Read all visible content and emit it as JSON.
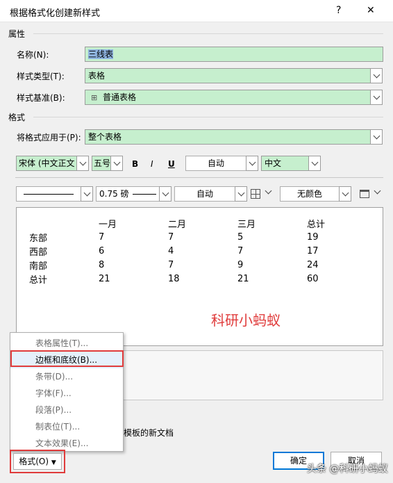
{
  "dialog": {
    "title": "根据格式化创建新样式",
    "help": "?",
    "close": "✕"
  },
  "properties": {
    "section": "属性",
    "name_label": "名称(N):",
    "name_value": "三线表",
    "type_label": "样式类型(T):",
    "type_value": "表格",
    "base_label": "样式基准(B):",
    "base_value": "普通表格"
  },
  "format": {
    "section": "格式",
    "apply_label": "将格式应用于(P):",
    "apply_value": "整个表格",
    "font_value": "宋体 (中文正文",
    "size_value": "五号",
    "bold": "B",
    "italic": "I",
    "underline": "U",
    "color_value": "自动",
    "script_value": "中文",
    "border_weight": "0.75 磅",
    "border_color": "自动",
    "shading": "无颜色"
  },
  "preview": {
    "headers": [
      "",
      "一月",
      "二月",
      "三月",
      "总计"
    ],
    "rows": [
      [
        "东部",
        "7",
        "7",
        "5",
        "19"
      ],
      [
        "西部",
        "6",
        "4",
        "7",
        "17"
      ],
      [
        "南部",
        "8",
        "7",
        "9",
        "24"
      ],
      [
        "总计",
        "21",
        "18",
        "21",
        "60"
      ]
    ],
    "watermark": "科研小蚂蚁"
  },
  "menu": {
    "items": [
      "表格属性(T)...",
      "边框和底纹(B)...",
      "条带(D)...",
      "字体(F)...",
      "段落(P)...",
      "制表位(T)...",
      "文本效果(E)..."
    ],
    "highlighted_index": 1
  },
  "footer": {
    "template_text": "模板的新文档",
    "format_button": "格式(O)",
    "ok_button": "确定",
    "cancel_button": "取消",
    "watermark": "头条 @科研小蚂蚁"
  },
  "colors": {
    "field_green": "#c6efce",
    "highlight_red": "#e03b3b",
    "watermark_red": "#e03c3c"
  }
}
